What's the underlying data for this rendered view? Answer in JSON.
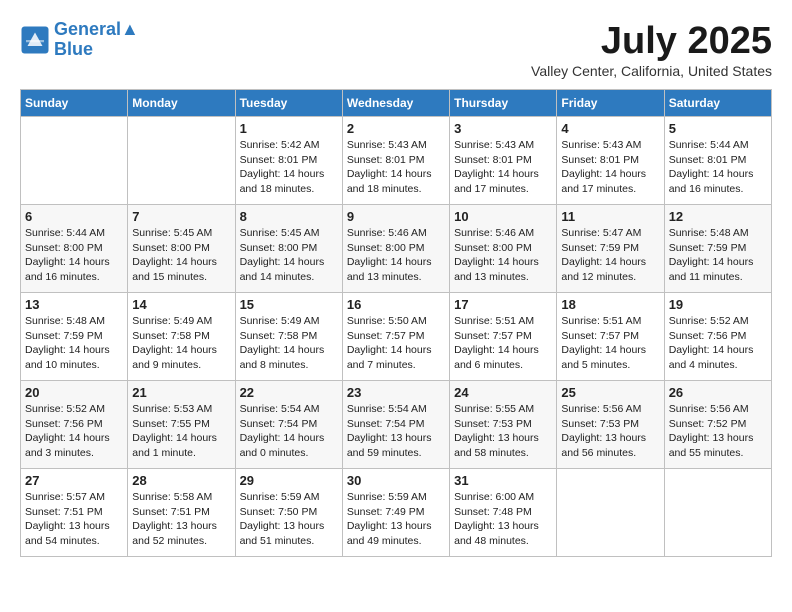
{
  "header": {
    "logo_line1": "General",
    "logo_line2": "Blue",
    "month_title": "July 2025",
    "location": "Valley Center, California, United States"
  },
  "days_of_week": [
    "Sunday",
    "Monday",
    "Tuesday",
    "Wednesday",
    "Thursday",
    "Friday",
    "Saturday"
  ],
  "weeks": [
    [
      {
        "day": "",
        "content": ""
      },
      {
        "day": "",
        "content": ""
      },
      {
        "day": "1",
        "content": "Sunrise: 5:42 AM\nSunset: 8:01 PM\nDaylight: 14 hours and 18 minutes."
      },
      {
        "day": "2",
        "content": "Sunrise: 5:43 AM\nSunset: 8:01 PM\nDaylight: 14 hours and 18 minutes."
      },
      {
        "day": "3",
        "content": "Sunrise: 5:43 AM\nSunset: 8:01 PM\nDaylight: 14 hours and 17 minutes."
      },
      {
        "day": "4",
        "content": "Sunrise: 5:43 AM\nSunset: 8:01 PM\nDaylight: 14 hours and 17 minutes."
      },
      {
        "day": "5",
        "content": "Sunrise: 5:44 AM\nSunset: 8:01 PM\nDaylight: 14 hours and 16 minutes."
      }
    ],
    [
      {
        "day": "6",
        "content": "Sunrise: 5:44 AM\nSunset: 8:00 PM\nDaylight: 14 hours and 16 minutes."
      },
      {
        "day": "7",
        "content": "Sunrise: 5:45 AM\nSunset: 8:00 PM\nDaylight: 14 hours and 15 minutes."
      },
      {
        "day": "8",
        "content": "Sunrise: 5:45 AM\nSunset: 8:00 PM\nDaylight: 14 hours and 14 minutes."
      },
      {
        "day": "9",
        "content": "Sunrise: 5:46 AM\nSunset: 8:00 PM\nDaylight: 14 hours and 13 minutes."
      },
      {
        "day": "10",
        "content": "Sunrise: 5:46 AM\nSunset: 8:00 PM\nDaylight: 14 hours and 13 minutes."
      },
      {
        "day": "11",
        "content": "Sunrise: 5:47 AM\nSunset: 7:59 PM\nDaylight: 14 hours and 12 minutes."
      },
      {
        "day": "12",
        "content": "Sunrise: 5:48 AM\nSunset: 7:59 PM\nDaylight: 14 hours and 11 minutes."
      }
    ],
    [
      {
        "day": "13",
        "content": "Sunrise: 5:48 AM\nSunset: 7:59 PM\nDaylight: 14 hours and 10 minutes."
      },
      {
        "day": "14",
        "content": "Sunrise: 5:49 AM\nSunset: 7:58 PM\nDaylight: 14 hours and 9 minutes."
      },
      {
        "day": "15",
        "content": "Sunrise: 5:49 AM\nSunset: 7:58 PM\nDaylight: 14 hours and 8 minutes."
      },
      {
        "day": "16",
        "content": "Sunrise: 5:50 AM\nSunset: 7:57 PM\nDaylight: 14 hours and 7 minutes."
      },
      {
        "day": "17",
        "content": "Sunrise: 5:51 AM\nSunset: 7:57 PM\nDaylight: 14 hours and 6 minutes."
      },
      {
        "day": "18",
        "content": "Sunrise: 5:51 AM\nSunset: 7:57 PM\nDaylight: 14 hours and 5 minutes."
      },
      {
        "day": "19",
        "content": "Sunrise: 5:52 AM\nSunset: 7:56 PM\nDaylight: 14 hours and 4 minutes."
      }
    ],
    [
      {
        "day": "20",
        "content": "Sunrise: 5:52 AM\nSunset: 7:56 PM\nDaylight: 14 hours and 3 minutes."
      },
      {
        "day": "21",
        "content": "Sunrise: 5:53 AM\nSunset: 7:55 PM\nDaylight: 14 hours and 1 minute."
      },
      {
        "day": "22",
        "content": "Sunrise: 5:54 AM\nSunset: 7:54 PM\nDaylight: 14 hours and 0 minutes."
      },
      {
        "day": "23",
        "content": "Sunrise: 5:54 AM\nSunset: 7:54 PM\nDaylight: 13 hours and 59 minutes."
      },
      {
        "day": "24",
        "content": "Sunrise: 5:55 AM\nSunset: 7:53 PM\nDaylight: 13 hours and 58 minutes."
      },
      {
        "day": "25",
        "content": "Sunrise: 5:56 AM\nSunset: 7:53 PM\nDaylight: 13 hours and 56 minutes."
      },
      {
        "day": "26",
        "content": "Sunrise: 5:56 AM\nSunset: 7:52 PM\nDaylight: 13 hours and 55 minutes."
      }
    ],
    [
      {
        "day": "27",
        "content": "Sunrise: 5:57 AM\nSunset: 7:51 PM\nDaylight: 13 hours and 54 minutes."
      },
      {
        "day": "28",
        "content": "Sunrise: 5:58 AM\nSunset: 7:51 PM\nDaylight: 13 hours and 52 minutes."
      },
      {
        "day": "29",
        "content": "Sunrise: 5:59 AM\nSunset: 7:50 PM\nDaylight: 13 hours and 51 minutes."
      },
      {
        "day": "30",
        "content": "Sunrise: 5:59 AM\nSunset: 7:49 PM\nDaylight: 13 hours and 49 minutes."
      },
      {
        "day": "31",
        "content": "Sunrise: 6:00 AM\nSunset: 7:48 PM\nDaylight: 13 hours and 48 minutes."
      },
      {
        "day": "",
        "content": ""
      },
      {
        "day": "",
        "content": ""
      }
    ]
  ]
}
